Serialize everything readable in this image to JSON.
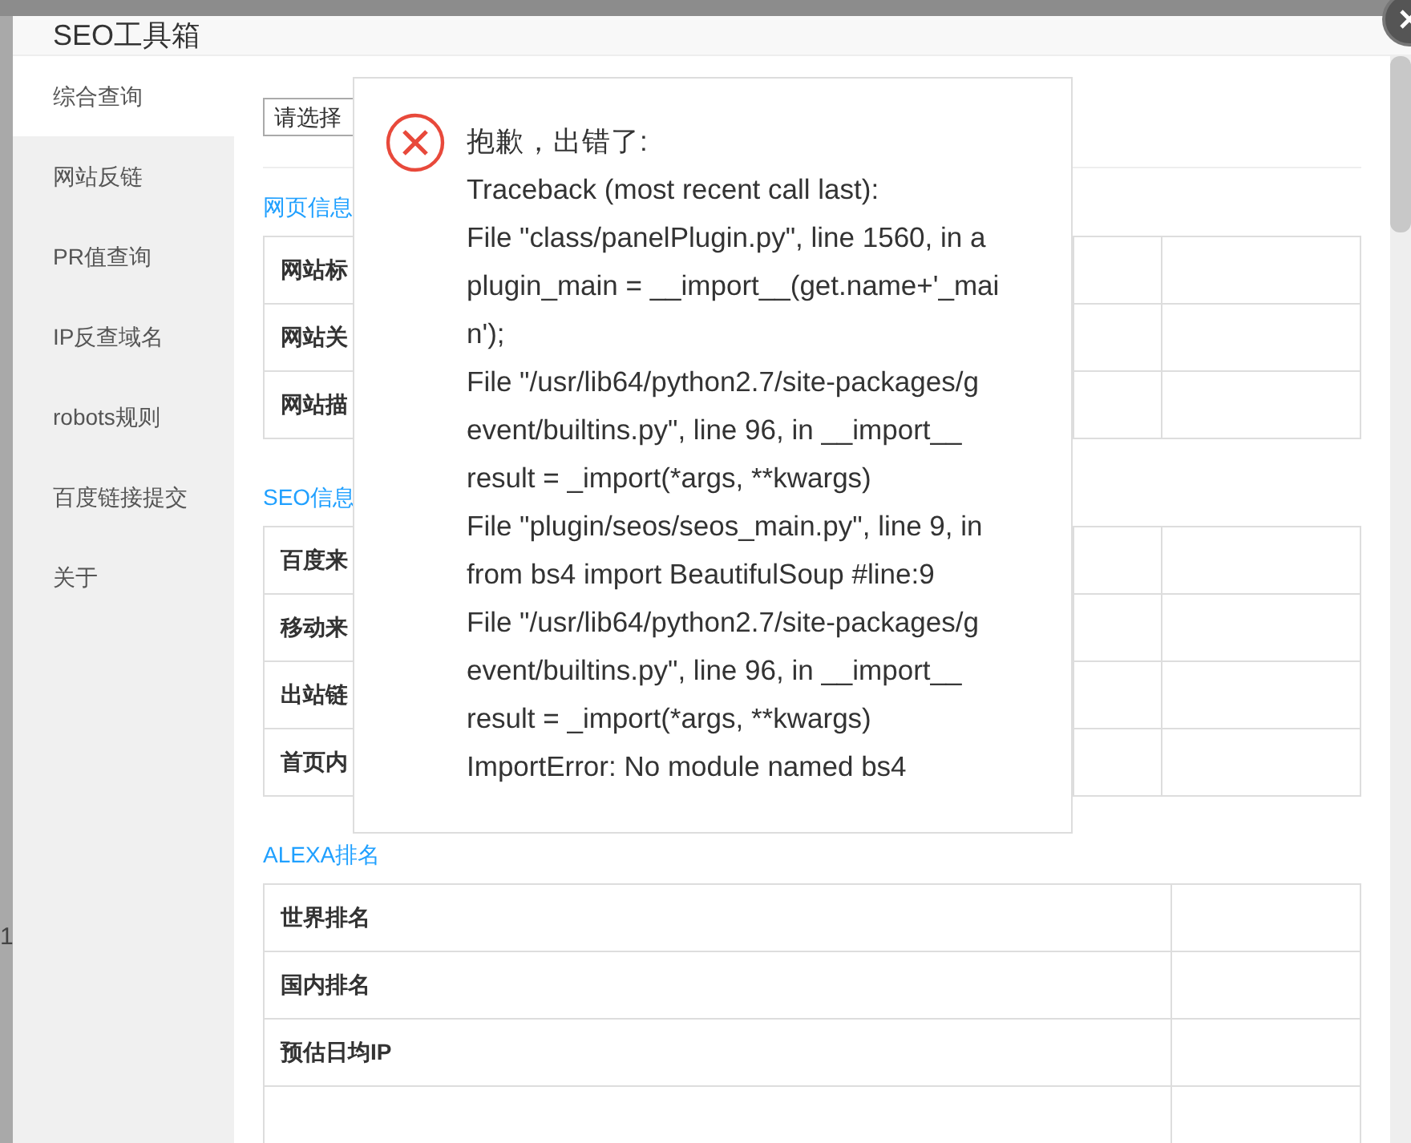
{
  "background_fragment": "1",
  "dialog": {
    "title": "SEO工具箱"
  },
  "sidebar": {
    "items": [
      {
        "label": "综合查询",
        "selected": true
      },
      {
        "label": "网站反链",
        "selected": false
      },
      {
        "label": "PR值查询",
        "selected": false
      },
      {
        "label": "IP反查域名",
        "selected": false
      },
      {
        "label": "robots规则",
        "selected": false
      },
      {
        "label": "百度链接提交",
        "selected": false
      },
      {
        "label": "关于",
        "selected": false
      }
    ]
  },
  "select": {
    "value": "请选择"
  },
  "sections": [
    {
      "title": "网页信息",
      "rows": [
        "网站标",
        "网站关",
        "网站描"
      ]
    },
    {
      "title": "SEO信息",
      "rows": [
        "百度来",
        "移动来",
        "出站链",
        "首页内"
      ]
    },
    {
      "title": "ALEXA排名",
      "rows": [
        "世界排名",
        "国内排名",
        "预估日均IP"
      ]
    }
  ],
  "error_popup": {
    "heading": "抱歉，出错了:",
    "lines": [
      "Traceback (most recent call last):",
      "File \"class/panelPlugin.py\", line 1560, in a",
      "plugin_main = __import__(get.name+'_mai",
      "n');",
      "File \"/usr/lib64/python2.7/site-packages/g",
      "event/builtins.py\", line 96, in __import__",
      "result = _import(*args, **kwargs)",
      "File \"plugin/seos/seos_main.py\", line 9, in",
      "from bs4 import BeautifulSoup #line:9",
      "File \"/usr/lib64/python2.7/site-packages/g",
      "event/builtins.py\", line 96, in __import__",
      "result = _import(*args, **kwargs)",
      "ImportError: No module named bs4"
    ]
  }
}
